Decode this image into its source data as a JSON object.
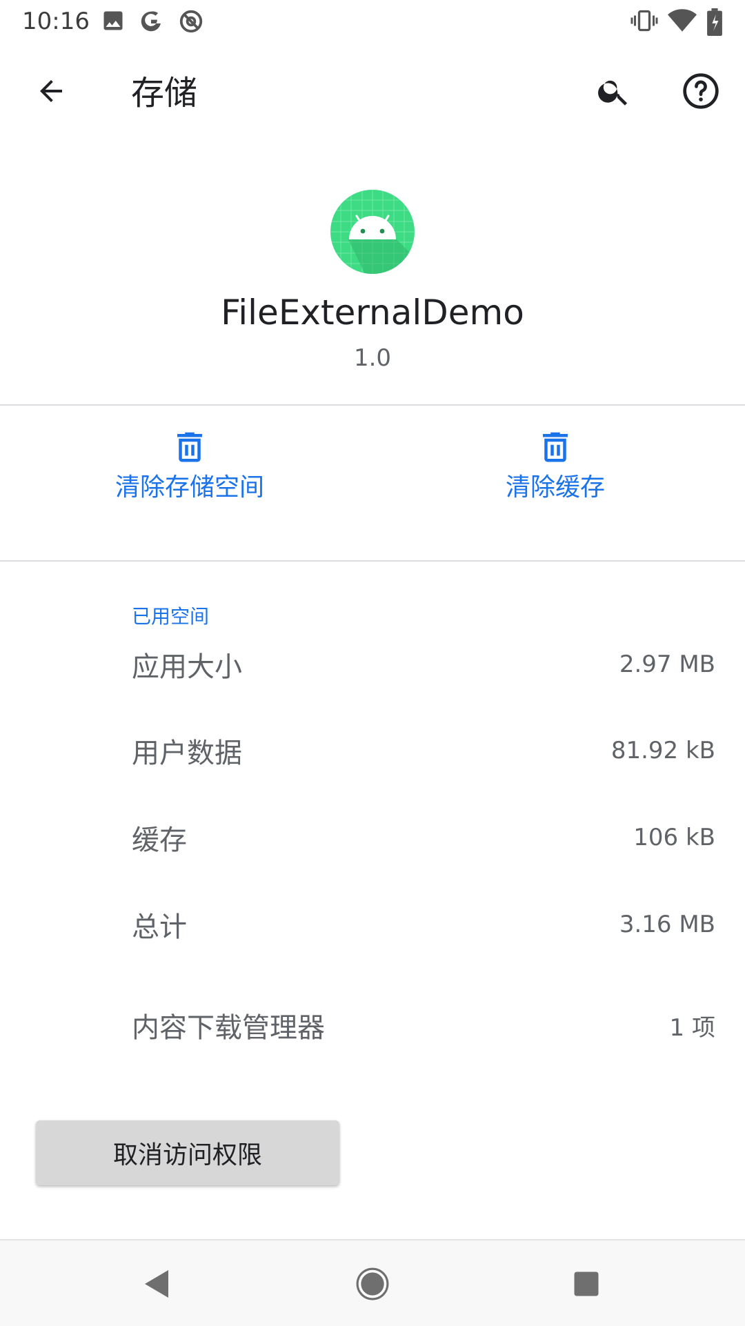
{
  "status_bar": {
    "time": "10:16",
    "left_icons": [
      "image-icon",
      "google-icon",
      "at-sign-icon"
    ],
    "right_icons": [
      "vibrate-icon",
      "wifi-icon",
      "battery-icon"
    ]
  },
  "app_bar": {
    "title": "存储",
    "actions": [
      "search-icon",
      "help-icon"
    ]
  },
  "app_info": {
    "name": "FileExternalDemo",
    "version": "1.0",
    "icon": "android-icon"
  },
  "actions": {
    "clear_storage_label": "清除存储空间",
    "clear_cache_label": "清除缓存"
  },
  "storage": {
    "section_header": "已用空间",
    "rows": [
      {
        "label": "应用大小",
        "value": "2.97 MB"
      },
      {
        "label": "用户数据",
        "value": "81.92 kB"
      },
      {
        "label": "缓存",
        "value": "106 kB"
      },
      {
        "label": "总计",
        "value": "3.16 MB"
      }
    ],
    "download_manager": {
      "label": "内容下载管理器",
      "value": "1 项"
    }
  },
  "revoke_button_label": "取消访问权限",
  "colors": {
    "accent": "#1a73e8",
    "app_icon_green": "#3ddc84",
    "button_gray": "#d7d7d7"
  }
}
